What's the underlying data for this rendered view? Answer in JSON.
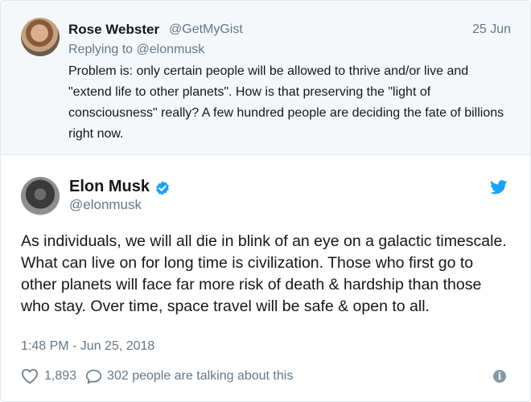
{
  "reply_tweet": {
    "author_name": "Rose Webster",
    "author_handle": "@GetMyGist",
    "date": "25 Jun",
    "replying_to": "Replying to @elonmusk",
    "text": "Problem is: only certain people will be allowed to thrive and/or live and \"extend life to other planets\". How is that preserving the \"light of consciousness\" really? A few hundred people are deciding the fate of billions right now."
  },
  "main_tweet": {
    "author_name": "Elon Musk",
    "author_handle": "@elonmusk",
    "verified": true,
    "text": "As individuals, we will all die in blink of an eye on a galactic timescale. What can live on for long time is civilization. Those who first go to other planets will face far more risk of death & hardship than those who stay. Over time, space travel will be safe & open to all.",
    "timestamp": "1:48 PM - Jun 25, 2018",
    "likes": "1,893",
    "talking": "302 people are talking about this"
  },
  "icons": {
    "verified": "verified-badge-icon",
    "bird": "twitter-bird-icon",
    "heart": "heart-icon",
    "reply": "reply-icon",
    "info": "info-icon"
  },
  "colors": {
    "twitter_blue": "#1da1f2",
    "secondary_text": "#657786",
    "reply_background": "#f5f8fa"
  }
}
